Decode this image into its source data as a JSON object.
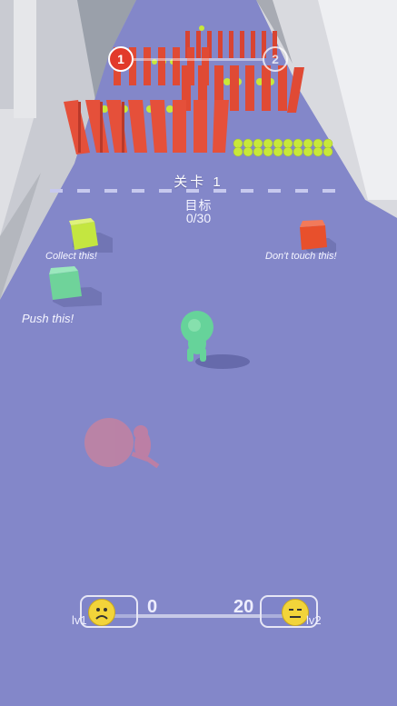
{
  "hud": {
    "progress": {
      "start_level": "1",
      "end_level": "2"
    },
    "level_title": "关卡 1",
    "goal_label": "目标",
    "goal_count": "0/30"
  },
  "hints": {
    "collect": "Collect this!",
    "avoid": "Don't touch this!",
    "push": "Push this!"
  },
  "score_bar": {
    "current": "0",
    "target": "20",
    "level_left": "lv1",
    "level_right": "lv2"
  },
  "colors": {
    "floor": "#8387c9",
    "pillar": "#e04a34",
    "ball": "#c8e83a",
    "collect_cube": "#b8e03c",
    "avoid_cube": "#e8502c",
    "push_cube": "#6fd39a",
    "player": "#66d39a",
    "ghost": "#e27a8e"
  },
  "icons": {
    "face_left": "sad-face-icon",
    "face_right": "neutral-face-icon"
  }
}
